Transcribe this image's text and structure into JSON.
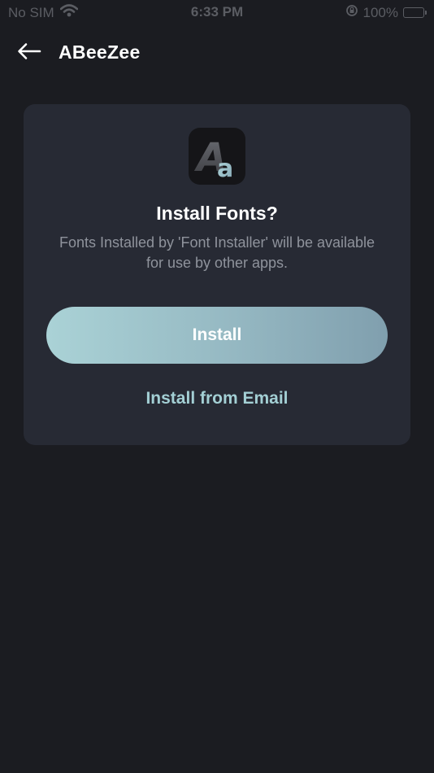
{
  "status_bar": {
    "carrier": "No SIM",
    "time": "6:33 PM",
    "battery": "100%",
    "battery_level": 1.0,
    "icons": [
      "wifi-icon",
      "orientation-lock-icon",
      "battery-charging-icon"
    ]
  },
  "nav": {
    "title": "ABeeZee",
    "back_icon": "arrow-left-icon"
  },
  "dialog": {
    "icon": "font-aa-app-icon",
    "icon_glyph_big": "A",
    "icon_glyph_small": "a",
    "title": "Install Fonts?",
    "description": "Fonts Installed by 'Font Installer' will be available for use by other apps.",
    "install_label": "Install",
    "install_email_label": "Install from Email"
  },
  "colors": {
    "background": "#1b1c21",
    "card": "#272a34",
    "accent": "#a3cfd4",
    "button_gradient_start": "#aad2d6",
    "button_gradient_end": "#809fae",
    "battery_green": "#34c759"
  }
}
